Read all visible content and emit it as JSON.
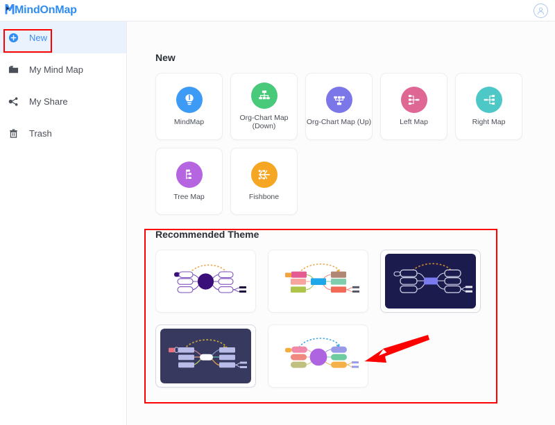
{
  "header": {
    "logo_text": "MindOnMap",
    "logo_color": "#3b8ff3",
    "account_icon": "user-circle-icon"
  },
  "sidebar": {
    "items": [
      {
        "label": "New",
        "icon": "plus-circle-icon",
        "active": true
      },
      {
        "label": "My Mind Map",
        "icon": "folder-icon",
        "active": false
      },
      {
        "label": "My Share",
        "icon": "share-nodes-icon",
        "active": false
      },
      {
        "label": "Trash",
        "icon": "trash-icon",
        "active": false
      }
    ],
    "active_bg": "#e9f2fd",
    "active_color": "#3d8ef0"
  },
  "main": {
    "new_section_title": "New",
    "map_types": [
      {
        "label": "MindMap",
        "icon": "lightbulb-icon",
        "color": "#3d9bf5"
      },
      {
        "label": "Org-Chart Map\n(Down)",
        "icon": "org-chart-down-icon",
        "color": "#49c97a"
      },
      {
        "label": "Org-Chart Map (Up)",
        "icon": "org-chart-up-icon",
        "color": "#7b77e8"
      },
      {
        "label": "Left Map",
        "icon": "left-map-icon",
        "color": "#de6793"
      },
      {
        "label": "Right Map",
        "icon": "right-map-icon",
        "color": "#4ec7c7"
      },
      {
        "label": "Tree Map",
        "icon": "tree-map-icon",
        "color": "#b濃"
      },
      {
        "label": "Fishbone",
        "icon": "fishbone-icon",
        "color": "#f5a623"
      }
    ],
    "theme_section_title": "Recommended Theme",
    "themes": [
      {
        "name": "theme-purple-light",
        "background": "#ffffff",
        "accent": "#3b0f7a"
      },
      {
        "name": "theme-colorful-light",
        "background": "#ffffff",
        "accent": "#1fa8e8"
      },
      {
        "name": "theme-dark-blue",
        "background": "#1b1b4d",
        "accent": "#7b7bf0"
      },
      {
        "name": "theme-dark-navy",
        "background": "#373a5e",
        "accent": "#ffffff"
      },
      {
        "name": "theme-pastel-light",
        "background": "#ffffff",
        "accent": "#a55fe0"
      }
    ]
  },
  "annotations": {
    "highlight_color": "#ff0000",
    "boxes": [
      {
        "name": "new-button-highlight"
      },
      {
        "name": "recommended-theme-highlight"
      }
    ],
    "arrow": {
      "name": "pointer-arrow",
      "color": "#ff0000",
      "points_to": "theme-pastel-light"
    }
  }
}
